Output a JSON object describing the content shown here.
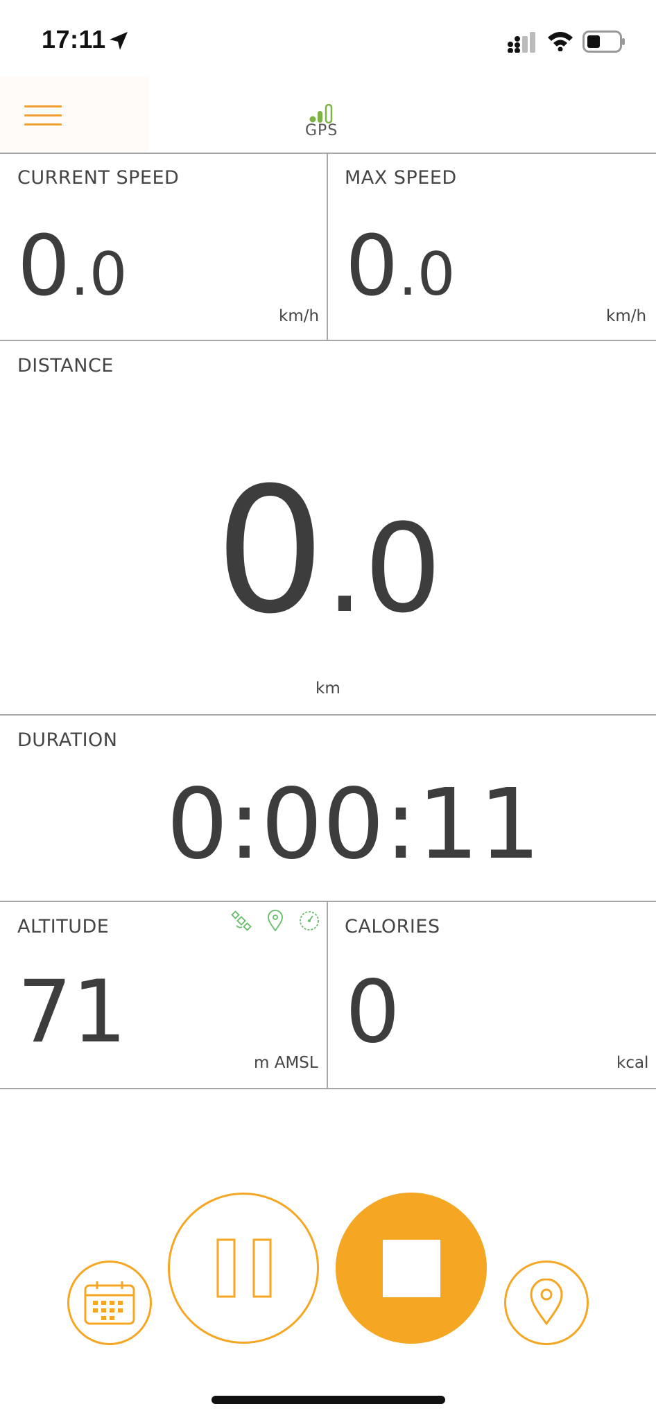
{
  "status_bar": {
    "time": "17:11"
  },
  "header": {
    "gps_label": "GPS"
  },
  "tiles": {
    "current_speed": {
      "label": "CURRENT SPEED",
      "int": "0",
      "dec": ".0",
      "unit": "km/h"
    },
    "max_speed": {
      "label": "MAX SPEED",
      "int": "0",
      "dec": ".0",
      "unit": "km/h"
    },
    "distance": {
      "label": "DISTANCE",
      "int": "0",
      "dec": ".0",
      "unit": "km"
    },
    "duration": {
      "label": "DURATION",
      "value": "0:00:11"
    },
    "altitude": {
      "label": "ALTITUDE",
      "value": "71",
      "unit": "m AMSL"
    },
    "calories": {
      "label": "CALORIES",
      "value": "0",
      "unit": "kcal"
    }
  },
  "colors": {
    "accent": "#f5a623",
    "gps_green": "#7cb342",
    "icon_green": "#66bb6a"
  },
  "icons": {
    "menu": "hamburger-icon",
    "altitude_sources": [
      "satellite-icon",
      "location-pin-icon",
      "barometer-icon"
    ],
    "controls": [
      "calendar-icon",
      "pause-icon",
      "stop-icon",
      "location-pin-icon"
    ]
  }
}
